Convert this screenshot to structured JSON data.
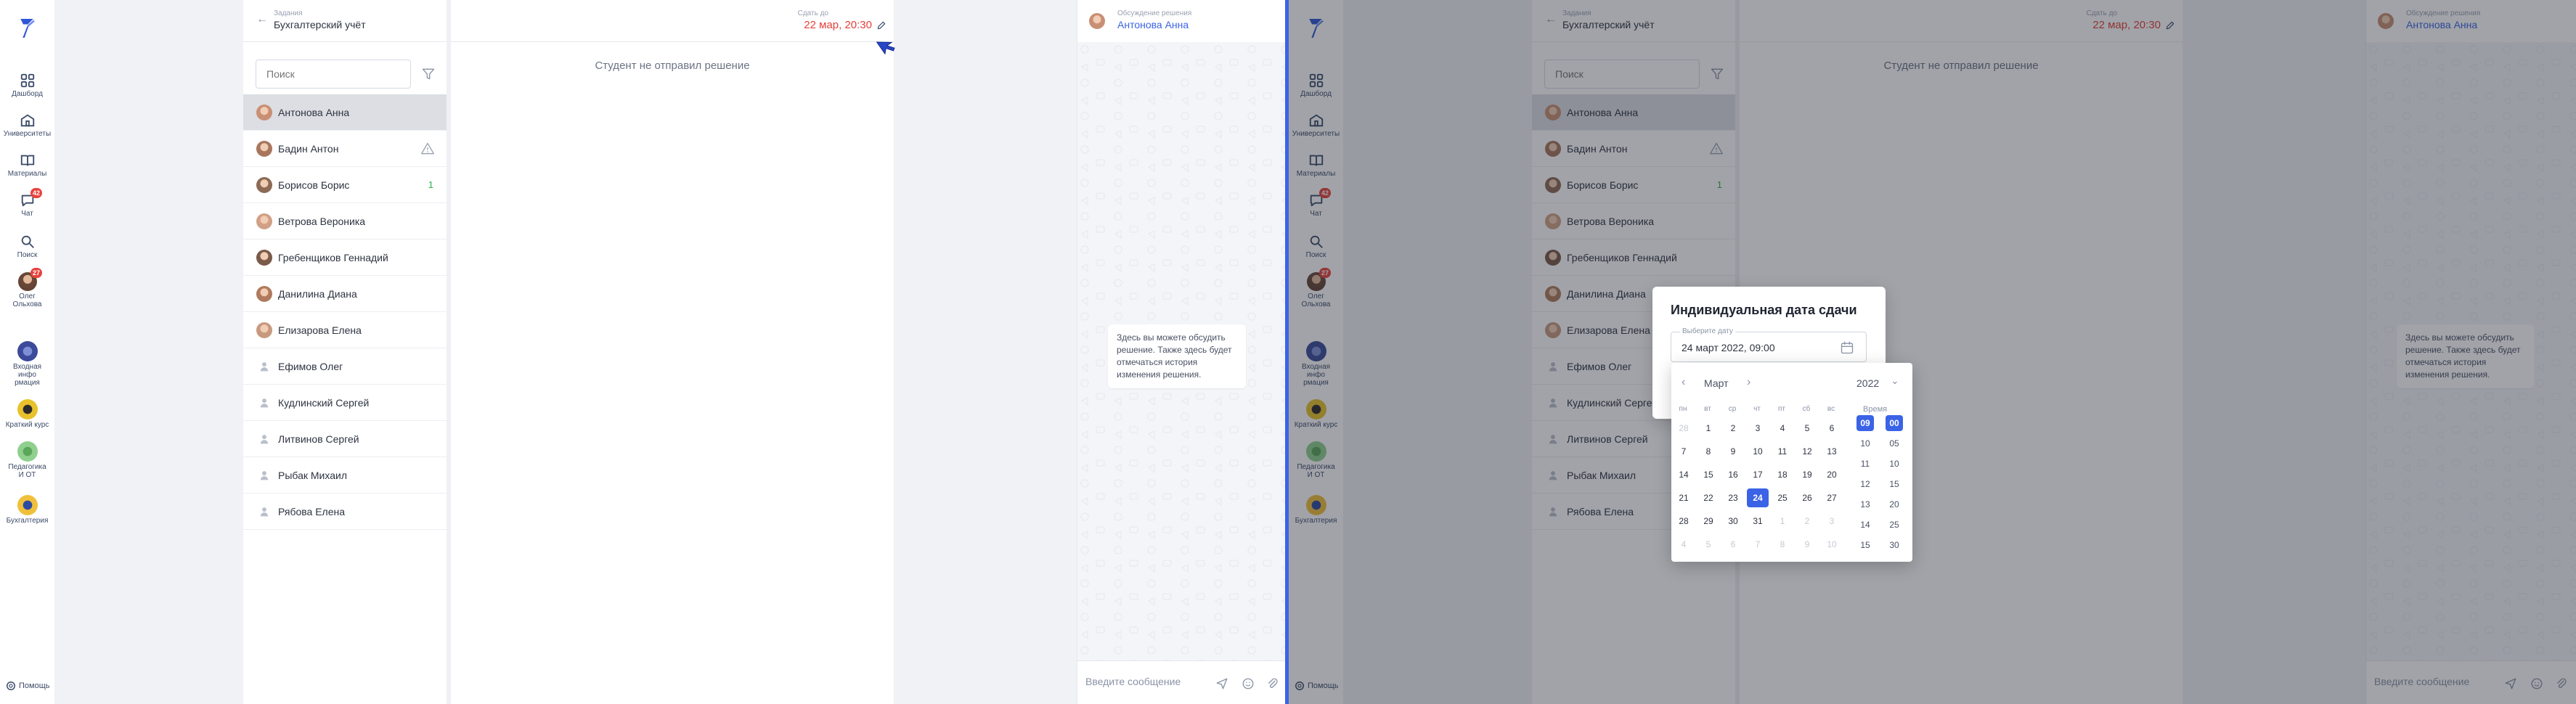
{
  "nav": {
    "items": [
      {
        "label": "Дашборд",
        "icon": "dashboard-icon"
      },
      {
        "label": "Университеты",
        "icon": "university-icon"
      },
      {
        "label": "Материалы",
        "icon": "book-icon"
      },
      {
        "label": "Чат",
        "icon": "chat-icon",
        "badge": "42"
      },
      {
        "label": "Поиск",
        "icon": "search-icon"
      },
      {
        "label": "Олег Ольхова",
        "icon": "profile-avatar",
        "badge": "27"
      }
    ],
    "courses": [
      {
        "label": "Входная инфо рмация",
        "icon": "course-info-icon"
      },
      {
        "label": "Краткий курс",
        "icon": "course-short-icon"
      },
      {
        "label": "Педагогика И ОТ",
        "icon": "course-pedagogy-icon"
      },
      {
        "label": "Бухгалтерия",
        "icon": "course-accounting-icon"
      }
    ],
    "help_label": "Помощь"
  },
  "list": {
    "assignment_small": "Задания",
    "assignment_title": "Бухгалтерский учёт",
    "search_placeholder": "Поиск",
    "students": [
      {
        "name": "Антонова Анна",
        "selected": true,
        "avatar": "photo"
      },
      {
        "name": "Бадин Антон",
        "avatar": "photo",
        "warning": true
      },
      {
        "name": "Борисов Борис",
        "avatar": "photo",
        "count": "1"
      },
      {
        "name": "Ветрова Вероника",
        "avatar": "photo"
      },
      {
        "name": "Гребенщиков Геннадий",
        "avatar": "photo"
      },
      {
        "name": "Данилина Диана",
        "avatar": "photo"
      },
      {
        "name": "Елизарова Елена",
        "avatar": "photo"
      },
      {
        "name": "Ефимов Олег",
        "avatar": "placeholder"
      },
      {
        "name": "Кудлинский Сергей",
        "avatar": "placeholder"
      },
      {
        "name": "Литвинов Сергей",
        "avatar": "placeholder"
      },
      {
        "name": "Рыбак Михаил",
        "avatar": "placeholder"
      },
      {
        "name": "Рябова Елена",
        "avatar": "placeholder"
      }
    ]
  },
  "assignment": {
    "due_label": "Сдать до",
    "due_value": "22 мар, 20:30",
    "no_solution": "Студент не отправил решение"
  },
  "chat": {
    "header_small": "Обсуждение решения",
    "header_title": "Антонова Анна",
    "hint": "Здесь вы можете обсудить решение. Также здесь будет отмечаться история изменения решения.",
    "input_placeholder": "Введите сообщение"
  },
  "modal": {
    "title": "Индивидуальная дата сдачи",
    "field_label": "Выберите дату",
    "field_value": "24 март 2022, 09:00",
    "picker": {
      "month": "Март",
      "year": "2022",
      "weekdays": [
        "пн",
        "вт",
        "ср",
        "чт",
        "пт",
        "сб",
        "вс"
      ],
      "weeks": [
        [
          "28",
          "1",
          "2",
          "3",
          "4",
          "5",
          "6"
        ],
        [
          "7",
          "8",
          "9",
          "10",
          "11",
          "12",
          "13"
        ],
        [
          "14",
          "15",
          "16",
          "17",
          "18",
          "19",
          "20"
        ],
        [
          "21",
          "22",
          "23",
          "24",
          "25",
          "26",
          "27"
        ],
        [
          "28",
          "29",
          "30",
          "31",
          "1",
          "2",
          "3"
        ],
        [
          "4",
          "5",
          "6",
          "7",
          "8",
          "9",
          "10"
        ]
      ],
      "selected_day": "24",
      "time_label": "Время",
      "hours": [
        "09",
        "10",
        "11",
        "12",
        "13",
        "14",
        "15"
      ],
      "minutes": [
        "00",
        "05",
        "10",
        "15",
        "20",
        "25",
        "30"
      ],
      "selected_hour": "09",
      "selected_minute": "00"
    }
  },
  "colors": {
    "accent": "#3b63e6",
    "danger": "#e3403a",
    "success": "#2db14e"
  }
}
